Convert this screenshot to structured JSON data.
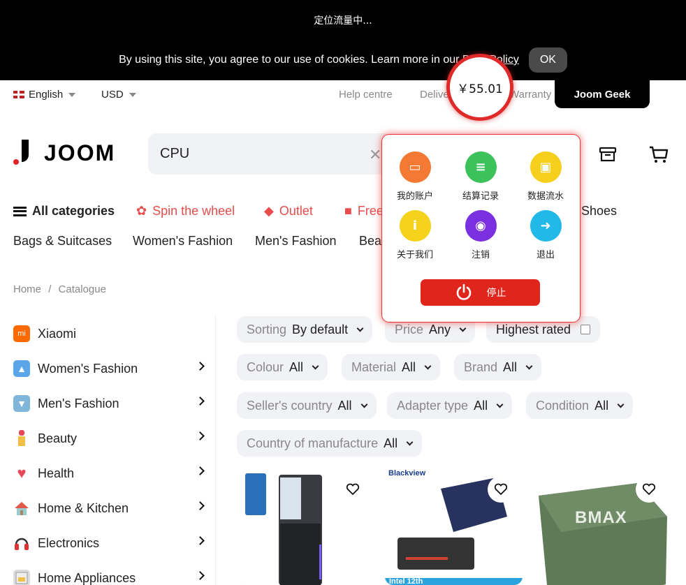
{
  "banner": {
    "text": "定位流量中..."
  },
  "cookie": {
    "text": "By using this site, you agree to our use of cookies. Learn more in our",
    "link": "Data Policy",
    "ok": "OK"
  },
  "util": {
    "language": "English",
    "currency": "USD",
    "help": "Help centre",
    "delivery": "Delivery",
    "warranty": "Warranty",
    "geek": "Joom Geek"
  },
  "header": {
    "logo": "JOOM",
    "search_value": "CPU"
  },
  "nav": {
    "all_categories": "All categories",
    "spin": "Spin the wheel",
    "outlet": "Outlet",
    "free": "Free",
    "shoes": "Shoes",
    "row2": [
      "Bags & Suitcases",
      "Women's Fashion",
      "Men's Fashion",
      "Beau"
    ]
  },
  "breadcrumb": {
    "home": "Home",
    "sep": "/",
    "current": "Catalogue"
  },
  "sidebar": {
    "items": [
      {
        "label": "Xiaomi",
        "icon": "xiaomi-icon"
      },
      {
        "label": "Women's Fashion",
        "icon": "dress-icon"
      },
      {
        "label": "Men's Fashion",
        "icon": "shirt-icon"
      },
      {
        "label": "Beauty",
        "icon": "lipstick-icon"
      },
      {
        "label": "Health",
        "icon": "heart-pulse-icon"
      },
      {
        "label": "Home & Kitchen",
        "icon": "house-icon"
      },
      {
        "label": "Electronics",
        "icon": "headphones-icon"
      },
      {
        "label": "Home Appliances",
        "icon": "appliance-icon"
      }
    ]
  },
  "filters": {
    "sorting": {
      "label": "Sorting",
      "value": "By default"
    },
    "price": {
      "label": "Price",
      "value": "Any"
    },
    "highest_rated": "Highest rated",
    "colour": {
      "label": "Colour",
      "value": "All"
    },
    "material": {
      "label": "Material",
      "value": "All"
    },
    "brand": {
      "label": "Brand",
      "value": "All"
    },
    "seller_country": {
      "label": "Seller's country",
      "value": "All"
    },
    "adapter": {
      "label": "Adapter type",
      "value": "All"
    },
    "condition": {
      "label": "Condition",
      "value": "All"
    },
    "manufacture": {
      "label": "Country of manufacture",
      "value": "All"
    }
  },
  "products": [
    {
      "brand": "",
      "caption": ""
    },
    {
      "brand": "Blackview",
      "caption": "Intel 12th"
    },
    {
      "brand": "BMAX",
      "caption": ""
    }
  ],
  "overlay": {
    "balance": "￥55.01",
    "items": [
      "我的账户",
      "结算记录",
      "数据流水",
      "关于我们",
      "注销",
      "退出"
    ],
    "stop": "停止"
  },
  "colors": {
    "accent": "#e84c4c",
    "stop": "#e0261c",
    "chip_bg": "#f1f2f5"
  }
}
